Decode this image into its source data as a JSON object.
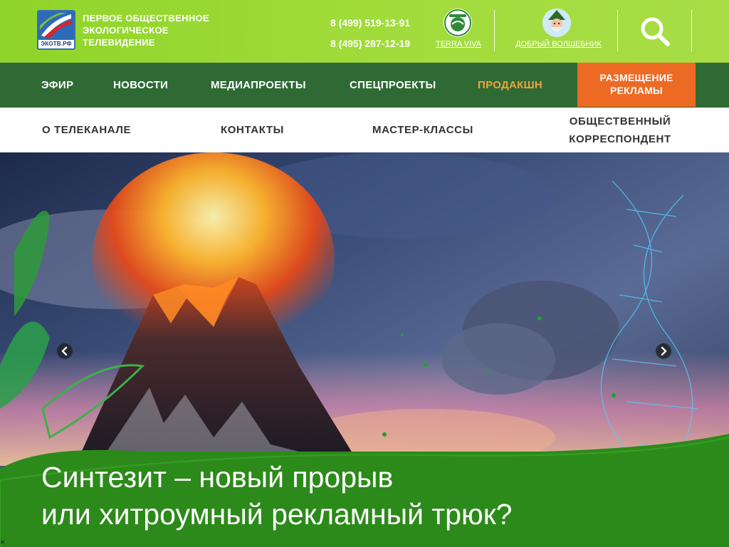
{
  "header": {
    "logo_caption": "ЭКОТВ.РФ",
    "brand_lines": [
      "ПЕРВОЕ ОБЩЕСТВЕННОЕ",
      "ЭКОЛОГИЧЕСКОЕ",
      "ТЕЛЕВИДЕНИЕ"
    ],
    "phones": [
      "8 (499) 519-13-91",
      "8 (495) 287-12-19"
    ],
    "partners": [
      {
        "label": "TERRA VIVA",
        "icon": "terra-viva-logo"
      },
      {
        "label": "ДОБРЫЙ ВОЛШЕБНИК",
        "icon": "wizard-avatar"
      }
    ],
    "search_icon": "search-icon"
  },
  "nav": {
    "items": [
      "ЭФИР",
      "НОВОСТИ",
      "МЕДИАПРОЕКТЫ",
      "СПЕЦПРОЕКТЫ",
      "ПРОДАКШН"
    ],
    "ad_button": "РАЗМЕЩЕНИЕ РЕКЛАМЫ"
  },
  "subnav": {
    "items": [
      "О ТЕЛЕКАНАЛЕ",
      "КОНТАКТЫ",
      "МАСТЕР-КЛАССЫ",
      "ОБЩЕСТВЕННЫЙ КОРРЕСПОНДЕНТ"
    ]
  },
  "hero": {
    "headline_line1": "Синтезит – новый прорыв",
    "headline_line2": "или хитроумный рекламный трюк?",
    "prev_icon": "chevron-left-icon",
    "next_icon": "chevron-right-icon",
    "close_icon": "close-icon",
    "close_glyph": "×"
  },
  "colors": {
    "header_green": "#9cda36",
    "nav_green": "#2f6a35",
    "accent_orange": "#ec6a24",
    "banner_green": "#2c8a1a"
  }
}
